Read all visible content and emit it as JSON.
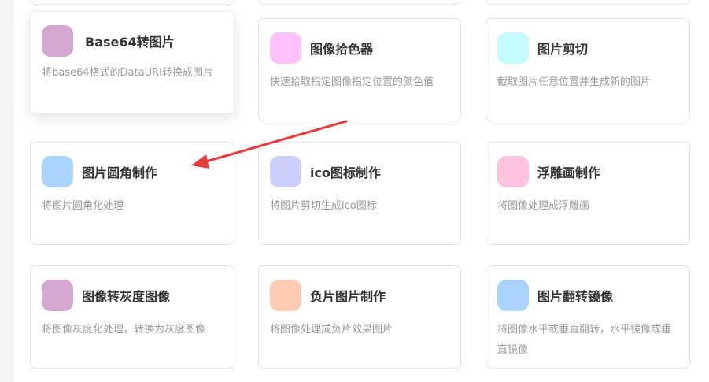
{
  "accent_colors": {
    "arrow": "#e83b3b",
    "card_border": "#e3e3e3",
    "title": "#333333",
    "desc": "#999999"
  },
  "tools": [
    {
      "title": "Base64转图片",
      "desc": "将base64格式的DataURI转换成图片",
      "icon": "tile-icon",
      "icon_color": "#d4a6d0"
    },
    {
      "title": "图像拾色器",
      "desc": "快速拾取指定图像指定位置的颜色值",
      "icon": "tile-icon",
      "icon_color": "#fdc1fb"
    },
    {
      "title": "图片剪切",
      "desc": "截取图片任意位置并生成新的图片",
      "icon": "tile-icon",
      "icon_color": "#c6fbfc"
    },
    {
      "title": "图片圆角制作",
      "desc": "将图片圆角化处理",
      "icon": "tile-icon",
      "icon_color": "#aad4fd"
    },
    {
      "title": "ico图标制作",
      "desc": "将图片剪切生成ico图标",
      "icon": "tile-icon",
      "icon_color": "#cccefe"
    },
    {
      "title": "浮雕画制作",
      "desc": "将图像处理成浮雕画",
      "icon": "tile-icon",
      "icon_color": "#fcc2e0"
    },
    {
      "title": "图像转灰度图像",
      "desc": "将图像灰度化处理，转换为灰度图像",
      "icon": "tile-icon",
      "icon_color": "#d4a6d0"
    },
    {
      "title": "负片图片制作",
      "desc": "将图像处理成负片效果图片",
      "icon": "tile-icon",
      "icon_color": "#fdcbb2"
    },
    {
      "title": "图片翻转镜像",
      "desc": "将图像水平或垂直翻转，水平镜像或垂直镜像",
      "icon": "tile-icon",
      "icon_color": "#aad4fd"
    }
  ]
}
